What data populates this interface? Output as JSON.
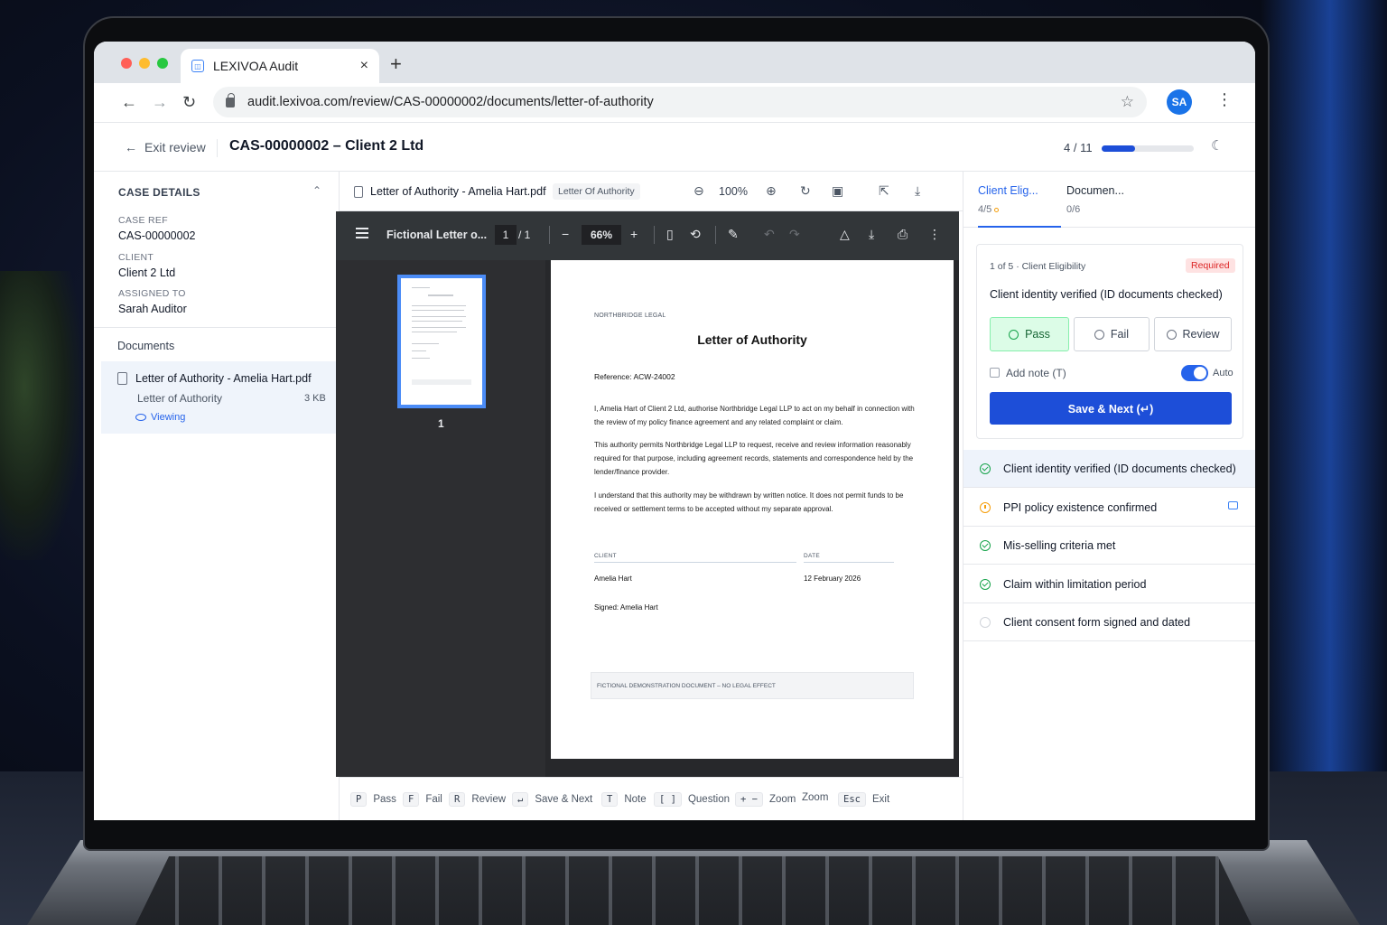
{
  "browser": {
    "tab_title": "LEXIVOA Audit",
    "tab_favicon": "scan-icon",
    "close": "×",
    "new_tab": "+",
    "url": "audit.lexivoa.com/review/CAS-00000002/documents/letter-of-authority",
    "avatar_initials": "SA"
  },
  "header": {
    "exit_label": "Exit review",
    "case_title": "CAS-00000002 – Client 2 Ltd",
    "progress_text": "4 / 11",
    "progress_fraction": 0.36
  },
  "sidebar": {
    "section_title": "CASE DETAILS",
    "fields": [
      {
        "key": "CASE REF",
        "value": "CAS-00000002"
      },
      {
        "key": "CLIENT",
        "value": "Client 2 Ltd"
      },
      {
        "key": "ASSIGNED TO",
        "value": "Sarah Auditor"
      }
    ],
    "documents_title": "Documents",
    "document": {
      "name": "Letter of Authority - Amelia Hart.pdf",
      "type": "Letter of Authority",
      "size": "3 KB",
      "status": "Viewing"
    }
  },
  "viewer": {
    "file_name": "Letter of Authority - Amelia Hart.pdf",
    "doc_type_chip": "Letter Of Authority",
    "zoom": "100%",
    "pdf": {
      "title": "Fictional Letter o...",
      "page": "1",
      "total": "/  1",
      "zoom": "66%",
      "thumb_label": "1"
    },
    "page": {
      "firm": "NORTHBRIDGE LEGAL",
      "title": "Letter of Authority",
      "reference": "Reference: ACW-24002",
      "para1": "I, Amelia Hart of Client 2 Ltd, authorise Northbridge Legal LLP to act on my behalf in connection with the review of my policy finance agreement and any related complaint or claim.",
      "para2": "This authority permits Northbridge Legal LLP to request, receive and review information reasonably required for that purpose, including agreement records, statements and correspondence held by the lender/finance provider.",
      "para3": "I understand that this authority may be withdrawn by written notice. It does not permit funds to be received or settlement terms to be accepted without my separate approval.",
      "client_label": "CLIENT",
      "date_label": "DATE",
      "client_value": "Amelia Hart",
      "date_value": "12 February 2026",
      "signed": "Signed: Amelia Hart",
      "footer": "FICTIONAL DEMONSTRATION DOCUMENT – NO LEGAL EFFECT"
    },
    "shortcuts": [
      {
        "key": "P",
        "label": "Pass"
      },
      {
        "key": "F",
        "label": "Fail"
      },
      {
        "key": "R",
        "label": "Review"
      },
      {
        "key": "↵",
        "label": "Save & Next"
      },
      {
        "key": "T",
        "label": "Note"
      },
      {
        "key": "[ ]",
        "label": "Question"
      },
      {
        "key": "+ −",
        "label": "Zoom"
      },
      {
        "key": "",
        "label": "Zoom"
      },
      {
        "key": "Esc",
        "label": "Exit"
      }
    ]
  },
  "panel": {
    "tabs": [
      {
        "label": "Client Elig...",
        "count": "4/5"
      },
      {
        "label": "Documen...",
        "count": "0/6"
      }
    ],
    "question": {
      "step": "1 of 5 · Client Eligibility",
      "required": "Required",
      "text": "Client identity verified (ID documents checked)",
      "options": [
        "Pass",
        "Fail",
        "Review"
      ],
      "selected": "Pass",
      "note_label": "Add note (T)",
      "auto_label": "Auto",
      "auto_on": true,
      "save_label": "Save & Next (↵)"
    },
    "criteria": [
      {
        "label": "Client identity verified (ID documents checked)",
        "status": "pass"
      },
      {
        "label": "PPI policy existence confirmed",
        "status": "pending"
      },
      {
        "label": "Mis-selling criteria met",
        "status": "pass"
      },
      {
        "label": "Claim within limitation period",
        "status": "pass"
      },
      {
        "label": "Client consent form signed and dated",
        "status": "empty"
      }
    ]
  },
  "colors": {
    "accent": "#1d4ed8",
    "pass": "#16a34a",
    "pending": "#f59e0b",
    "required": "#dc2626"
  }
}
